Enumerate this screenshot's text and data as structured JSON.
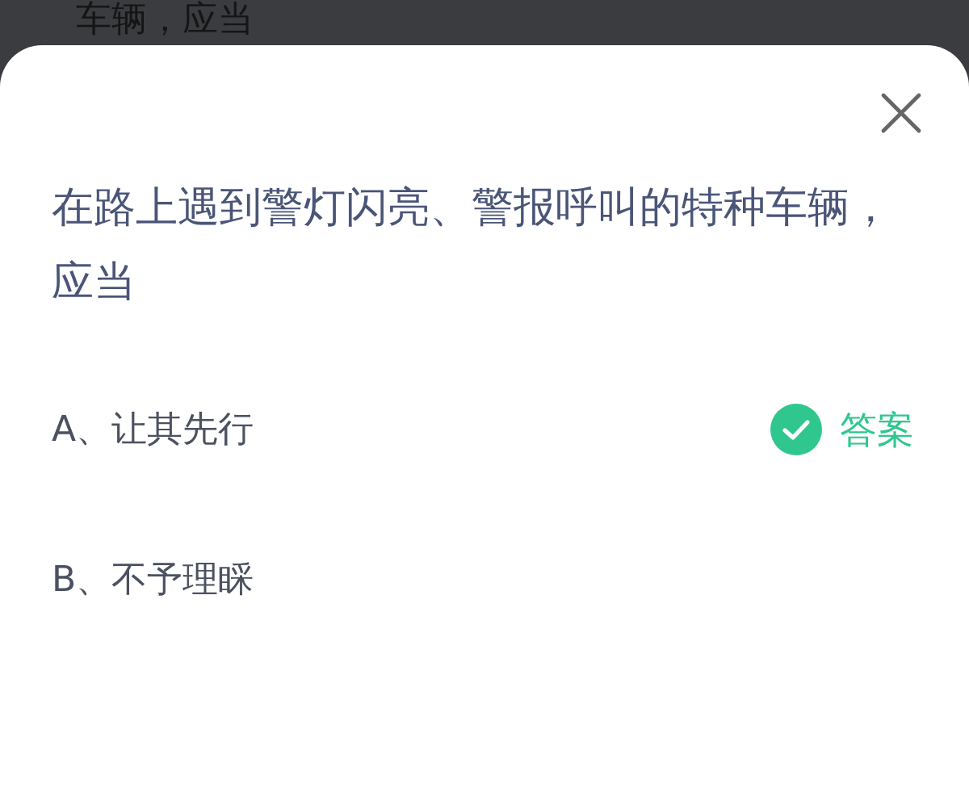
{
  "background": {
    "text": "车辆，应当"
  },
  "question": {
    "text": "在路上遇到警灯闪亮、警报呼叫的特种车辆，应当"
  },
  "answer_label": "答案",
  "options": [
    {
      "text": "A、让其先行",
      "correct": true
    },
    {
      "text": "B、不予理睬",
      "correct": false
    }
  ]
}
